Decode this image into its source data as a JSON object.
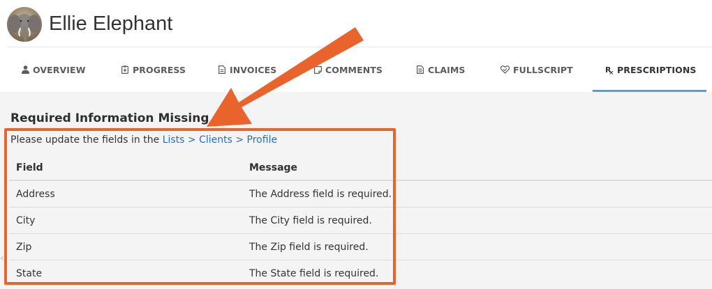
{
  "client": {
    "name": "Ellie Elephant",
    "avatar_icon": "elephant-photo"
  },
  "tabs": [
    {
      "label": "OVERVIEW",
      "icon": "person-icon"
    },
    {
      "label": "PROGRESS",
      "icon": "clipboard-icon"
    },
    {
      "label": "INVOICES",
      "icon": "document-icon"
    },
    {
      "label": "COMMENTS",
      "icon": "note-icon"
    },
    {
      "label": "CLAIMS",
      "icon": "file-list-icon"
    },
    {
      "label": "FULLSCRIPT",
      "icon": "heart-icon"
    },
    {
      "label": "PRESCRIPTIONS",
      "icon": "rx-icon",
      "active": true
    }
  ],
  "missing_info": {
    "title": "Required Information Missing",
    "instruction_prefix": "Please update the fields in the ",
    "instruction_link": "Lists > Clients > Profile",
    "columns": [
      "Field",
      "Message"
    ],
    "rows": [
      [
        "Address",
        "The Address field is required."
      ],
      [
        "City",
        "The City field is required."
      ],
      [
        "Zip",
        "The Zip field is required."
      ],
      [
        "State",
        "The State field is required."
      ]
    ]
  },
  "colors": {
    "annotation": "#e8642c",
    "tab_accent": "#4aa3df",
    "link": "#2a6ebb"
  }
}
